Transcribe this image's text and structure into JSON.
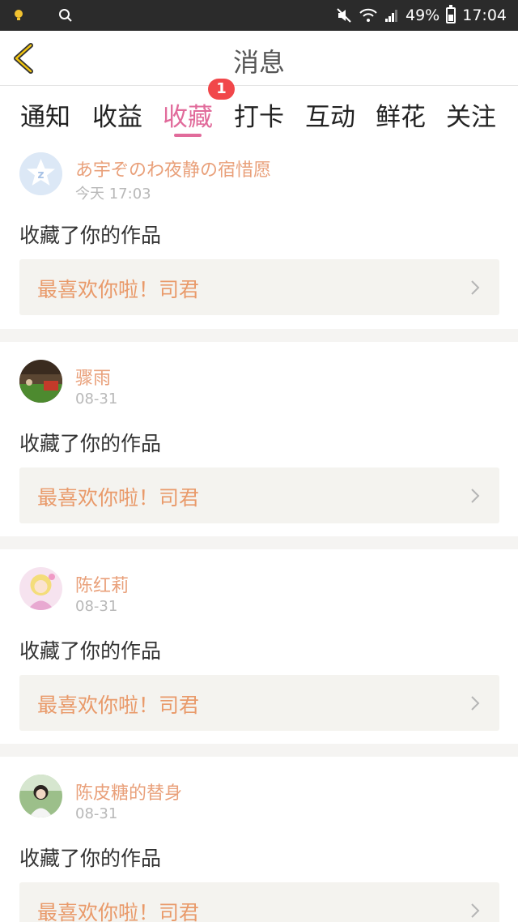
{
  "status_bar": {
    "battery": "49%",
    "time": "17:04"
  },
  "header": {
    "title": "消息"
  },
  "tabs": [
    {
      "label": "通知"
    },
    {
      "label": "收益"
    },
    {
      "label": "收藏",
      "active": true,
      "badge": "1"
    },
    {
      "label": "打卡"
    },
    {
      "label": "互动"
    },
    {
      "label": "鲜花"
    },
    {
      "label": "关注"
    }
  ],
  "messages": [
    {
      "username": "あ宇ぞのわ夜静の宿惜愿",
      "time": "今天 17:03",
      "action": "收藏了你的作品",
      "work_title": "最喜欢你啦！司君",
      "avatar_icon": "qq-default-avatar-icon"
    },
    {
      "username": "骤雨",
      "time": "08-31",
      "action": "收藏了你的作品",
      "work_title": "最喜欢你啦！司君",
      "avatar_icon": "photo-avatar"
    },
    {
      "username": "陈红莉",
      "time": "08-31",
      "action": "收藏了你的作品",
      "work_title": "最喜欢你啦！司君",
      "avatar_icon": "anime-avatar"
    },
    {
      "username": "陈皮糖的替身",
      "time": "08-31",
      "action": "收藏了你的作品",
      "work_title": "最喜欢你啦！司君",
      "avatar_icon": "photo-avatar"
    }
  ],
  "colors": {
    "accent_pink": "#e16b9b",
    "username_orange": "#e9a07a",
    "badge_red": "#f1474a",
    "link_bg": "#f4f3ef"
  }
}
